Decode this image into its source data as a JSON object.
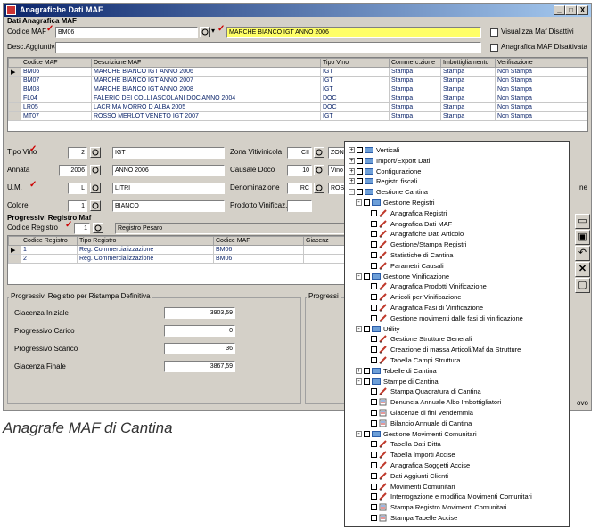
{
  "window": {
    "title": "Anagrafiche Dati MAF",
    "buttons": [
      "_",
      "□",
      "X"
    ]
  },
  "anagrafica": {
    "section_label": "Dati Anagrafica MAF",
    "codice_label": "Codice MAF",
    "codice_value": "BM06",
    "codice_desc": "MARCHE BIANCO IGT ANNO 2006",
    "desc_label": "Desc.Aggiuntiva",
    "desc_value": "",
    "visualizza_label": "Visualizza Maf Disattivi",
    "anagrafica_disattivata_label": "Anagrafica MAF Disattivata"
  },
  "maf_table": {
    "columns": [
      "Codice MAF",
      "Descrizione MAF",
      "Tipo Vino",
      "Commerc.zione",
      "Imbottigliamento",
      "Verificazione"
    ],
    "rows": [
      {
        "codice": "BM06",
        "descrizione": "MARCHE BIANCO IGT ANNO 2006",
        "tipo": "IGT",
        "comm": "Stampa",
        "imb": "Stampa",
        "ver": "Non Stampa"
      },
      {
        "codice": "BM07",
        "descrizione": "MARCHE BIANCO IGT ANNO 2007",
        "tipo": "IGT",
        "comm": "Stampa",
        "imb": "Stampa",
        "ver": "Non Stampa"
      },
      {
        "codice": "BM08",
        "descrizione": "MARCHE BIANCO IGT ANNO 2008",
        "tipo": "IGT",
        "comm": "Stampa",
        "imb": "Stampa",
        "ver": "Non Stampa"
      },
      {
        "codice": "FL04",
        "descrizione": "FALERIO DEI COLLI ASCOLANI DOC ANNO 2004",
        "tipo": "DOC",
        "comm": "Stampa",
        "imb": "Stampa",
        "ver": "Non Stampa"
      },
      {
        "codice": "LR05",
        "descrizione": "LACRIMA MORRO D ALBA 2005",
        "tipo": "DOC",
        "comm": "Stampa",
        "imb": "Stampa",
        "ver": "Non Stampa"
      },
      {
        "codice": "MT07",
        "descrizione": "ROSSO MERLOT VENETO IGT 2007",
        "tipo": "IGT",
        "comm": "Stampa",
        "imb": "Stampa",
        "ver": "Non Stampa"
      }
    ]
  },
  "details": {
    "tipo_vino_label": "Tipo Vino",
    "tipo_vino_code": "2",
    "tipo_vino_desc": "IGT",
    "annata_label": "Annata",
    "annata_code": "2006",
    "annata_desc": "ANNO 2006",
    "um_label": "U.M.",
    "um_code": "L",
    "um_desc": "LITRI",
    "colore_label": "Colore",
    "colore_code": "1",
    "colore_desc": "BIANCO",
    "zona_label": "Zona Vitivinicola",
    "zona_code": "CII",
    "zona_desc": "ZON",
    "causale_label": "Causale Doco",
    "causale_code": "10",
    "causale_desc": "Vino",
    "denom_label": "Denominazione",
    "denom_code": "RC",
    "denom_desc": "ROS",
    "prodotto_label": "Prodotto Vinificaz.",
    "prodotto_code": "",
    "side_text": "ne"
  },
  "registri": {
    "section_label": "Progressivi Registro Maf",
    "codice_label": "Codice Registro",
    "codice_value": "1",
    "codice_desc": "Registro Pesaro",
    "columns": [
      "Codice Registro",
      "Tipo Registro",
      "Codice MAF",
      "Giacenz"
    ],
    "rows": [
      {
        "codice": "1",
        "tipo": "Reg. Commercializzazione",
        "maf": "BM06"
      },
      {
        "codice": "2",
        "tipo": "Reg. Commercializzazione",
        "maf": "BM06"
      }
    ]
  },
  "progressivi": {
    "group_label": "Progressivi Registro per Ristampa Definitiva",
    "group2_label": "Progressi",
    "giacenza_iniziale_label": "Giacenza Iniziale",
    "giacenza_iniziale": "3903,59",
    "carico_label": "Progressivo Carico",
    "carico": "0",
    "scarico_label": "Progressivo Scarico",
    "scarico": "36",
    "giacenza_finale_label": "Giacenza Finale",
    "giacenza_finale": "3867,59",
    "footer_text": "ovo"
  },
  "caption": "Anagrafe MAF di Cantina",
  "tree": [
    {
      "label": "Verticali",
      "level": 0,
      "type": "folder",
      "exp": "+"
    },
    {
      "label": "Import/Export Dati",
      "level": 0,
      "type": "folder",
      "exp": "+"
    },
    {
      "label": "Configurazione",
      "level": 0,
      "type": "folder",
      "exp": "+"
    },
    {
      "label": "Registri fiscali",
      "level": 0,
      "type": "folder",
      "exp": "+"
    },
    {
      "label": "Gestione Cantina",
      "level": 0,
      "type": "folder",
      "exp": "-"
    },
    {
      "label": "Gestione Registri",
      "level": 1,
      "type": "folder",
      "exp": "-"
    },
    {
      "label": "Anagrafica Registri",
      "level": 2,
      "type": "item"
    },
    {
      "label": "Anagrafica Dati MAF",
      "level": 2,
      "type": "item"
    },
    {
      "label": "Anagrafiche Dati Articolo",
      "level": 2,
      "type": "item"
    },
    {
      "label": "Gestione/Stampa Registri",
      "level": 2,
      "type": "item",
      "underline": true
    },
    {
      "label": "Statistiche di Cantina",
      "level": 2,
      "type": "item"
    },
    {
      "label": "Parametri Causali",
      "level": 2,
      "type": "item"
    },
    {
      "label": "Gestione Vinificazione",
      "level": 1,
      "type": "folder",
      "exp": "-"
    },
    {
      "label": "Anagrafica Prodotti Vinificazione",
      "level": 2,
      "type": "item"
    },
    {
      "label": "Articoli per Vinificazione",
      "level": 2,
      "type": "item"
    },
    {
      "label": "Anagrafica Fasi di Vinificazione",
      "level": 2,
      "type": "item"
    },
    {
      "label": "Gestione movimenti dalle fasi di vinificazione",
      "level": 2,
      "type": "item"
    },
    {
      "label": "Utility",
      "level": 1,
      "type": "folder",
      "exp": "-"
    },
    {
      "label": "Gestione Strutture Generali",
      "level": 2,
      "type": "item"
    },
    {
      "label": "Creazione di massa Articoli/Maf da Strutture",
      "level": 2,
      "type": "item"
    },
    {
      "label": "Tabella Campi Struttura",
      "level": 2,
      "type": "item"
    },
    {
      "label": "Tabelle di Cantina",
      "level": 1,
      "type": "folder",
      "exp": "+"
    },
    {
      "label": "Stampe di Cantina",
      "level": 1,
      "type": "folder",
      "exp": "-"
    },
    {
      "label": "Stampa Quadratura di Cantina",
      "level": 2,
      "type": "item"
    },
    {
      "label": "Denuncia Annuale Albo Imbottigliatori",
      "level": 2,
      "type": "report"
    },
    {
      "label": "Giacenze di fini Vendemmia",
      "level": 2,
      "type": "report"
    },
    {
      "label": "Bilancio Annuale di Cantina",
      "level": 2,
      "type": "report"
    },
    {
      "label": "Gestione Movimenti Comunitari",
      "level": 1,
      "type": "folder",
      "exp": "-"
    },
    {
      "label": "Tabella Dati Ditta",
      "level": 2,
      "type": "item"
    },
    {
      "label": "Tabella Importi Accise",
      "level": 2,
      "type": "item"
    },
    {
      "label": "Anagrafica Soggetti Accise",
      "level": 2,
      "type": "item"
    },
    {
      "label": "Dati Aggiunti Clienti",
      "level": 2,
      "type": "item"
    },
    {
      "label": "Movimenti Comunitari",
      "level": 2,
      "type": "item"
    },
    {
      "label": "Interrogazione e modifica Movimenti Comunitari",
      "level": 2,
      "type": "item"
    },
    {
      "label": "Stampa Registro Movimenti Comunitari",
      "level": 2,
      "type": "report"
    },
    {
      "label": "Stampa Tabelle Accise",
      "level": 2,
      "type": "report"
    }
  ]
}
